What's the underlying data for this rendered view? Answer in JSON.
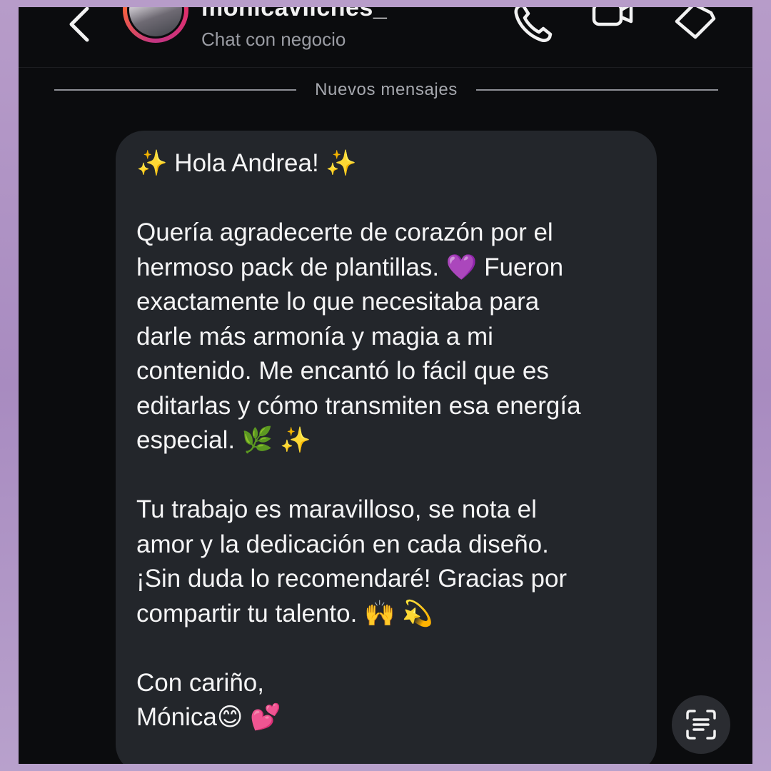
{
  "header": {
    "username": "monicavilches_",
    "subtitle": "Chat con negocio",
    "icons": [
      "back-chevron-icon",
      "phone-icon",
      "video-camera-icon",
      "tag-icon"
    ]
  },
  "divider": {
    "label": "Nuevos mensajes"
  },
  "message": {
    "greeting": "✨ Hola Andrea! ✨",
    "paragraph_1": "Quería agradecerte de corazón por el\nhermoso pack de plantillas. 💜 Fueron\nexactamente lo que necesitaba para\ndarle más armonía y magia a mi\ncontenido. Me encantó lo fácil que es\neditarlas y cómo transmiten esa energía\nespecial. 🌿 ✨",
    "paragraph_2": "Tu trabajo es maravilloso, se nota el\namor y la dedicación en cada diseño.\n¡Sin duda lo recomendaré! Gracias por\ncompartir tu talento. 🙌 💫",
    "closing": "Con cariño,",
    "signature": "Mónica😊 💕"
  },
  "floating_button": {
    "icon": "scan-text-icon"
  },
  "colors": {
    "frame": "#b79cc9",
    "background": "#0b0c0e",
    "bubble": "#23262b",
    "text": "#f4f4f5",
    "muted": "#9a9ca3"
  }
}
